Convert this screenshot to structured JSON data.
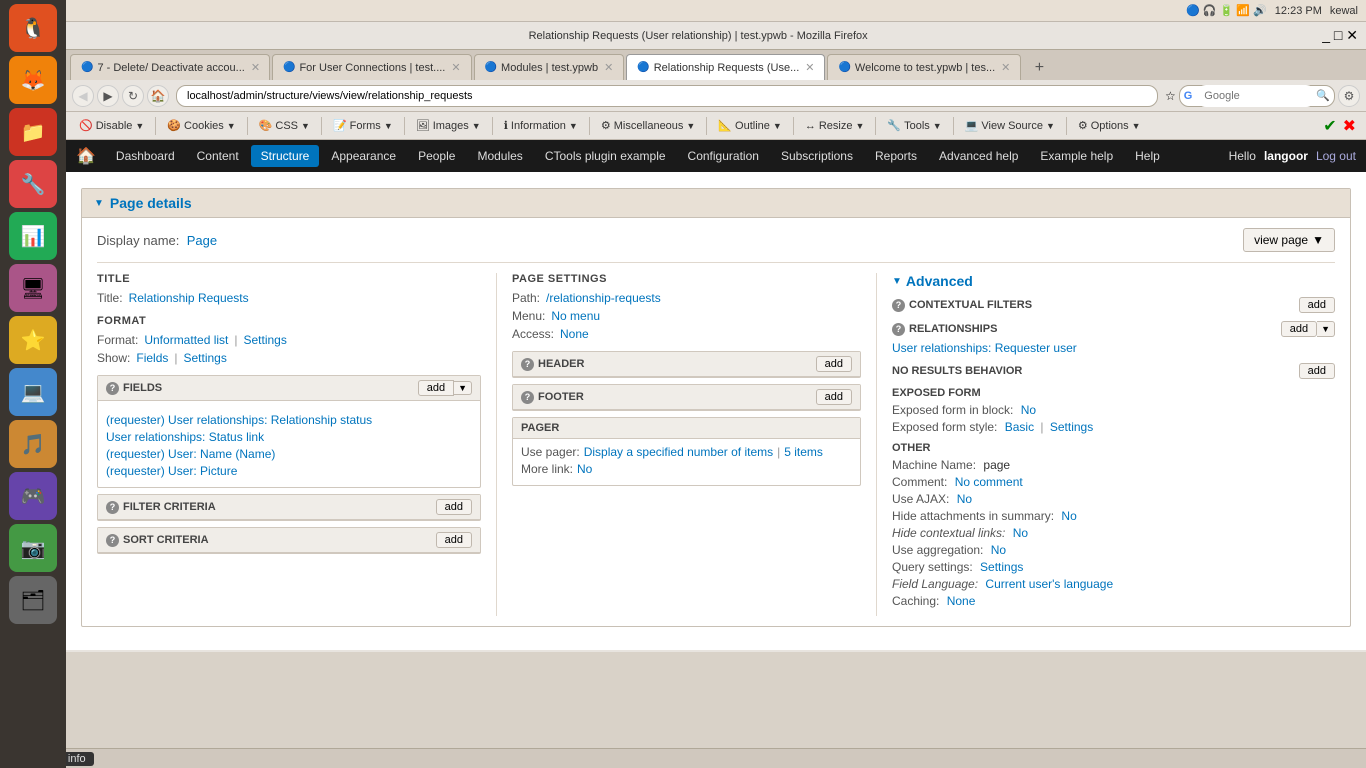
{
  "browser": {
    "title": "Relationship Requests (User relationship) | test.ypwb - Mozilla Firefox",
    "address": "localhost/admin/structure/views/view/relationship_requests",
    "tabs": [
      {
        "id": "tab1",
        "label": "7 - Delete/ Deactivate accou...",
        "active": false,
        "icon": "🔵"
      },
      {
        "id": "tab2",
        "label": "For User Connections | test....",
        "active": false,
        "icon": "🔵"
      },
      {
        "id": "tab3",
        "label": "Modules | test.ypwb",
        "active": false,
        "icon": "🔵"
      },
      {
        "id": "tab4",
        "label": "Relationship Requests (Use...",
        "active": true,
        "icon": "🔵"
      },
      {
        "id": "tab5",
        "label": "Welcome to test.ypwb | tes...",
        "active": false,
        "icon": "🔵"
      }
    ],
    "toolbar": {
      "disable": "Disable",
      "cookies": "Cookies",
      "css": "CSS",
      "forms": "Forms",
      "images": "Images",
      "information": "Information",
      "miscellaneous": "Miscellaneous",
      "outline": "Outline",
      "resize": "Resize",
      "tools": "Tools",
      "view_source": "View Source",
      "options": "Options"
    },
    "time": "12:23 PM",
    "user_system": "kewal"
  },
  "drupal": {
    "top_nav": {
      "hello": "Hello",
      "username": "langoor",
      "logout": "Log out"
    },
    "nav_items": [
      {
        "label": "Dashboard",
        "active": false
      },
      {
        "label": "Content",
        "active": false
      },
      {
        "label": "Structure",
        "active": true
      },
      {
        "label": "Appearance",
        "active": false
      },
      {
        "label": "People",
        "active": false
      },
      {
        "label": "Modules",
        "active": false
      },
      {
        "label": "CTools plugin example",
        "active": false
      },
      {
        "label": "Configuration",
        "active": false
      },
      {
        "label": "Subscriptions",
        "active": false
      },
      {
        "label": "Reports",
        "active": false
      },
      {
        "label": "Advanced help",
        "active": false
      },
      {
        "label": "Example help",
        "active": false
      },
      {
        "label": "Help",
        "active": false
      }
    ]
  },
  "page": {
    "section_title": "Page details",
    "display_name_label": "Display name:",
    "display_name_value": "Page",
    "view_page_btn": "view page",
    "title_section": "TITLE",
    "title_label": "Title:",
    "title_value": "Relationship Requests",
    "format_section": "FORMAT",
    "format_label": "Format:",
    "format_value": "Unformatted list",
    "format_settings": "Settings",
    "show_label": "Show:",
    "show_fields": "Fields",
    "show_settings": "Settings",
    "fields_section": "FIELDS",
    "fields_add_btn": "add",
    "fields": [
      "(requester) User relationships: Relationship status",
      "User relationships: Status link",
      "(requester) User: Name (Name)",
      "(requester) User: Picture"
    ],
    "filter_section": "FILTER CRITERIA",
    "filter_add": "add",
    "sort_section": "SORT CRITERIA",
    "sort_add": "add",
    "page_settings_section": "PAGE SETTINGS",
    "path_label": "Path:",
    "path_value": "/relationship-requests",
    "menu_label": "Menu:",
    "menu_value": "No menu",
    "access_label": "Access:",
    "access_value": "None",
    "header_section": "HEADER",
    "header_add": "add",
    "footer_section": "FOOTER",
    "footer_add": "add",
    "pager_section": "PAGER",
    "pager_use_label": "Use pager:",
    "pager_display": "Display a specified number of items",
    "pager_count": "5 items",
    "pager_more_label": "More link:",
    "pager_more_value": "No",
    "advanced_section": "Advanced",
    "contextual_filters": "CONTEXTUAL FILTERS",
    "contextual_add": "add",
    "relationships_section": "RELATIONSHIPS",
    "relationships_add": "add",
    "relationships_value": "User relationships: Requester user",
    "no_results_section": "NO RESULTS BEHAVIOR",
    "no_results_add": "add",
    "exposed_form_section": "EXPOSED FORM",
    "exposed_form_block_label": "Exposed form in block:",
    "exposed_form_block_value": "No",
    "exposed_form_style_label": "Exposed form style:",
    "exposed_form_basic": "Basic",
    "exposed_form_settings": "Settings",
    "other_section": "OTHER",
    "machine_name_label": "Machine Name:",
    "machine_name_value": "page",
    "comment_label": "Comment:",
    "comment_value": "No comment",
    "use_ajax_label": "Use AJAX:",
    "use_ajax_value": "No",
    "hide_attachments_label": "Hide attachments in summary:",
    "hide_attachments_value": "No",
    "hide_contextual_label": "Hide contextual links:",
    "hide_contextual_value": "No",
    "use_aggregation_label": "Use aggregation:",
    "use_aggregation_value": "No",
    "query_settings_label": "Query settings:",
    "query_settings_value": "Settings",
    "field_language_label": "Field Language:",
    "field_language_value": "Current user's language",
    "caching_label": "Caching:",
    "caching_value": "None"
  },
  "themer": {
    "label": "Themer info"
  }
}
